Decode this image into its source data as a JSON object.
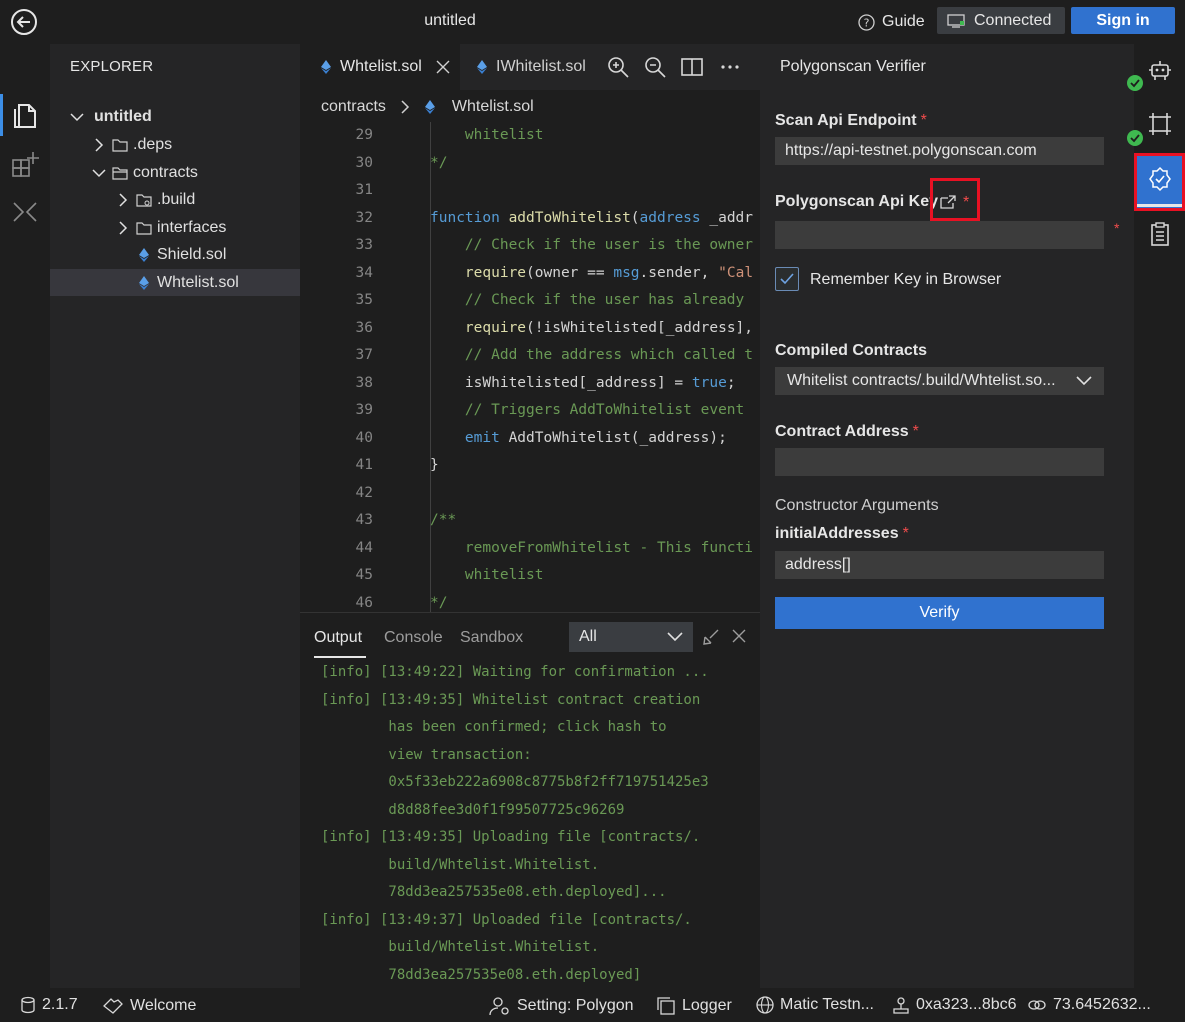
{
  "titlebar": {
    "title": "untitled",
    "guide_label": "Guide",
    "connected_label": "Connected",
    "signin_label": "Sign in"
  },
  "explorer": {
    "title": "EXPLORER",
    "tree": [
      {
        "label": "untitled",
        "level": 0,
        "type": "root",
        "expanded": true
      },
      {
        "label": ".deps",
        "level": 1,
        "type": "folder",
        "expanded": false
      },
      {
        "label": "contracts",
        "level": 1,
        "type": "folder",
        "expanded": true
      },
      {
        "label": ".build",
        "level": 2,
        "type": "folder-special",
        "expanded": false
      },
      {
        "label": "interfaces",
        "level": 2,
        "type": "folder",
        "expanded": false
      },
      {
        "label": "Shield.sol",
        "level": 2,
        "type": "sol"
      },
      {
        "label": "Whtelist.sol",
        "level": 2,
        "type": "sol",
        "selected": true
      }
    ]
  },
  "editor": {
    "tabs": [
      {
        "label": "Whtelist.sol",
        "active": true
      },
      {
        "label": "IWhitelist.sol",
        "active": false
      }
    ],
    "breadcrumb": {
      "folder": "contracts",
      "file": "Whtelist.sol"
    },
    "lines": [
      {
        "n": "29",
        "parts": [
          {
            "t": "    whitelist",
            "c": "cm"
          }
        ]
      },
      {
        "n": "30",
        "parts": [
          {
            "t": "*/",
            "c": "cm"
          }
        ]
      },
      {
        "n": "31",
        "parts": []
      },
      {
        "n": "32",
        "parts": [
          {
            "t": "function ",
            "c": "kw"
          },
          {
            "t": "addToWhitelist",
            "c": "fn"
          },
          {
            "t": "(",
            "c": ""
          },
          {
            "t": "address",
            "c": "kw"
          },
          {
            "t": " _addr",
            "c": ""
          }
        ]
      },
      {
        "n": "33",
        "parts": [
          {
            "t": "    // Check if the user is the owner",
            "c": "cm"
          }
        ]
      },
      {
        "n": "34",
        "parts": [
          {
            "t": "    require",
            "c": "fn"
          },
          {
            "t": "(owner == ",
            "c": ""
          },
          {
            "t": "msg",
            "c": "kw"
          },
          {
            "t": ".sender, ",
            "c": ""
          },
          {
            "t": "\"Cal",
            "c": "str"
          }
        ]
      },
      {
        "n": "35",
        "parts": [
          {
            "t": "    // Check if the user has already",
            "c": "cm"
          }
        ]
      },
      {
        "n": "36",
        "parts": [
          {
            "t": "    require",
            "c": "fn"
          },
          {
            "t": "(!isWhitelisted[_address],",
            "c": ""
          }
        ]
      },
      {
        "n": "37",
        "parts": [
          {
            "t": "    // Add the address which called t",
            "c": "cm"
          }
        ]
      },
      {
        "n": "38",
        "parts": [
          {
            "t": "    isWhitelisted[_address] = ",
            "c": ""
          },
          {
            "t": "true",
            "c": "kw"
          },
          {
            "t": ";",
            "c": ""
          }
        ]
      },
      {
        "n": "39",
        "parts": [
          {
            "t": "    // Triggers AddToWhitelist event",
            "c": "cm"
          }
        ]
      },
      {
        "n": "40",
        "parts": [
          {
            "t": "    emit ",
            "c": "kw"
          },
          {
            "t": "AddToWhitelist(_address);",
            "c": ""
          }
        ]
      },
      {
        "n": "41",
        "parts": [
          {
            "t": "}",
            "c": ""
          }
        ]
      },
      {
        "n": "42",
        "parts": []
      },
      {
        "n": "43",
        "parts": [
          {
            "t": "/**",
            "c": "cm"
          }
        ]
      },
      {
        "n": "44",
        "parts": [
          {
            "t": "    removeFromWhitelist - This functi",
            "c": "cm"
          }
        ]
      },
      {
        "n": "45",
        "parts": [
          {
            "t": "    whitelist",
            "c": "cm"
          }
        ]
      },
      {
        "n": "46",
        "parts": [
          {
            "t": "*/",
            "c": "cm"
          }
        ]
      }
    ]
  },
  "panel": {
    "tabs": [
      "Output",
      "Console",
      "Sandbox"
    ],
    "filter_value": "All",
    "log_lines": [
      "[info] [13:49:22] Waiting for confirmation ...",
      "[info] [13:49:35] Whitelist contract creation",
      "        has been confirmed; click hash to",
      "        view transaction:",
      "        0x5f33eb222a6908c8775b8f2ff719751425e3",
      "        d8d88fee3d0f1f99507725c96269",
      "[info] [13:49:35] Uploading file [contracts/.",
      "        build/Whtelist.Whitelist.",
      "        78dd3ea257535e08.eth.deployed]...",
      "[info] [13:49:37] Uploaded file [contracts/.",
      "        build/Whtelist.Whitelist.",
      "        78dd3ea257535e08.eth.deployed]"
    ]
  },
  "verifier": {
    "title": "Polygonscan Verifier",
    "scan_api_label": "Scan Api Endpoint",
    "scan_api_value": "https://api-testnet.polygonscan.com",
    "api_key_label": "Polygonscan Api Key",
    "api_key_value": "",
    "remember_label": "Remember Key in Browser",
    "remember_checked": true,
    "compiled_label": "Compiled Contracts",
    "compiled_value": "Whitelist contracts/.build/Whtelist.so...",
    "address_label": "Contract Address",
    "address_value": "",
    "ctor_label": "Constructor Arguments",
    "initial_label": "initialAddresses",
    "initial_placeholder": "address[]",
    "verify_label": "Verify",
    "required_mark": "*"
  },
  "statusbar": {
    "version": "2.1.7",
    "welcome": "Welcome",
    "setting": "Setting: Polygon",
    "logger": "Logger",
    "network": "Matic Testn...",
    "account": "0xa323...8bc6",
    "balance": "73.6452632..."
  },
  "colors": {
    "accent": "#3072cf",
    "highlight": "#e81123",
    "success": "#3fb950",
    "log": "#6a9955"
  }
}
